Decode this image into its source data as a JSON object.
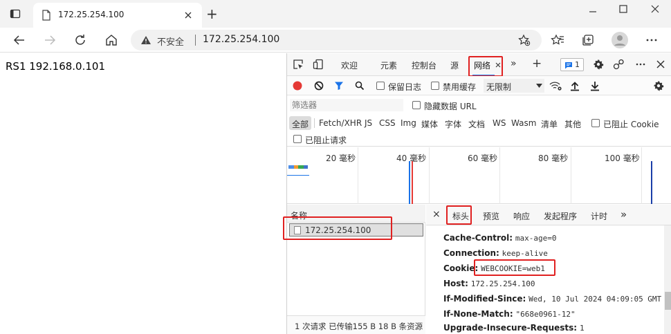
{
  "browser": {
    "tab_title": "172.25.254.100",
    "new_tab": "+",
    "insecure_label": "不安全",
    "url": "172.25.254.100"
  },
  "page": {
    "text": "RS1 192.168.0.101"
  },
  "devtools": {
    "tabs": {
      "welcome": "欢迎",
      "elements": "元素",
      "console": "控制台",
      "sources": "源",
      "network": "网络",
      "more": "»",
      "add": "+"
    },
    "issues_count": "1",
    "controls": {
      "preserve_log": "保留日志",
      "disable_cache": "禁用缓存",
      "throttle": "无限制"
    },
    "filter": {
      "placeholder": "筛选器",
      "hide_data_urls": "隐藏数据 URL"
    },
    "types": [
      "全部",
      "Fetch/XHR",
      "JS",
      "CSS",
      "Img",
      "媒体",
      "字体",
      "文档",
      "WS",
      "Wasm",
      "清单",
      "其他"
    ],
    "blocked_cookies": "已阻止 Cookie",
    "blocked_requests": "已阻止请求",
    "timeline_ticks": [
      "20 毫秒",
      "40 毫秒",
      "60 毫秒",
      "80 毫秒",
      "100 毫秒"
    ],
    "requests": {
      "column_name": "名称",
      "rows": [
        "172.25.254.100"
      ],
      "status": "1 次请求  已传输155 B  18 B 条资源"
    },
    "details": {
      "close": "×",
      "tabs": [
        "标头",
        "预览",
        "响应",
        "发起程序",
        "计时"
      ],
      "more": "»",
      "headers": [
        {
          "name": "Cache-Control:",
          "value": "max-age=0"
        },
        {
          "name": "Connection:",
          "value": "keep-alive"
        },
        {
          "name": "Cookie:",
          "value": "WEBCOOKIE=web1"
        },
        {
          "name": "Host:",
          "value": "172.25.254.100"
        },
        {
          "name": "If-Modified-Since:",
          "value": "Wed, 10 Jul 2024 04:09:05 GMT"
        },
        {
          "name": "If-None-Match:",
          "value": "\"668e0961-12\""
        },
        {
          "name": "Upgrade-Insecure-Requests:",
          "value": "1"
        }
      ]
    }
  },
  "colors": {
    "accent": "#1a73e8",
    "record": "#e53935",
    "highlight_box": "#e02020"
  }
}
